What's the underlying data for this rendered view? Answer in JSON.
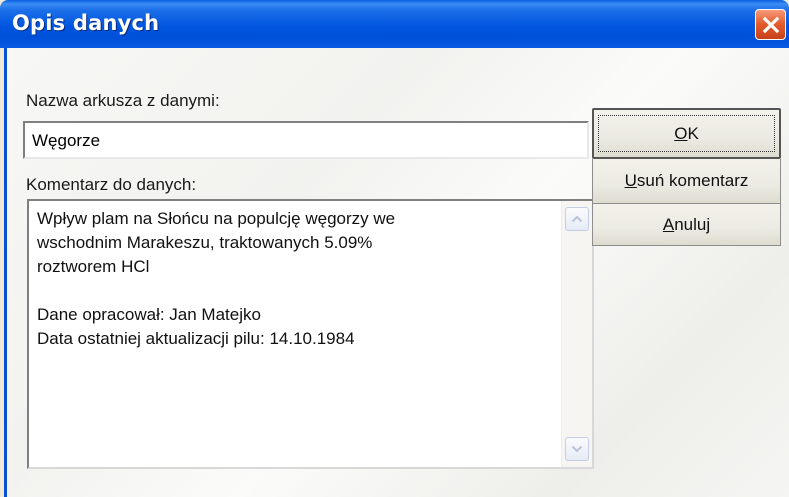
{
  "window": {
    "title": "Opis danych"
  },
  "form": {
    "sheet_label": "Nazwa arkusza z danymi:",
    "sheet_value": "Węgorze",
    "comment_label": "Komentarz do danych:",
    "comment_lines": [
      "Wpływ plam na Słońcu na populcję węgorzy we",
      "wschodnim Marakeszu, traktowanych 5.09%",
      "roztworem HCl",
      "",
      "Dane opracował: Jan Matejko",
      "Data ostatniej aktualizacji pilu: 14.10.1984"
    ]
  },
  "buttons": {
    "ok": {
      "mnemonic": "O",
      "rest": "K"
    },
    "remove": {
      "mnemonic": "U",
      "rest": "suń komentarz"
    },
    "cancel": {
      "mnemonic": "A",
      "rest": "nuluj"
    }
  },
  "icons": {
    "close": "close-icon",
    "scroll_up": "chevron-up-icon",
    "scroll_down": "chevron-down-icon"
  },
  "colors": {
    "titlebar": "#0055e0",
    "close_button": "#e25a2a",
    "dialog_bg": "#f4f4f2"
  }
}
